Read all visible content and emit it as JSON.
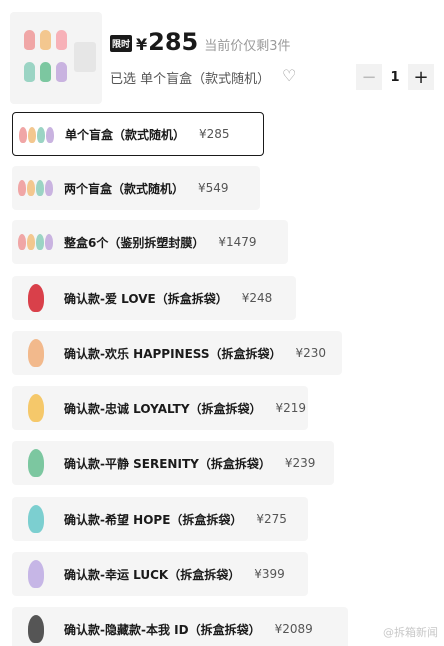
{
  "product": {
    "tag": "限时",
    "currency": "¥",
    "price": "285",
    "stock_text": "当前价仅剩3件",
    "selected_text": "已选 单个盲盒（款式随机）",
    "quantity": "1",
    "minus_symbol": "−",
    "plus_symbol": "+"
  },
  "options": [
    {
      "name": "单个盲盒（款式随机）",
      "price": "¥285",
      "selected": true,
      "colors": [
        "#f0a6a6",
        "#f3c78f",
        "#9bd4c4",
        "#c9b3e0"
      ]
    },
    {
      "name": "两个盲盒（款式随机）",
      "price": "¥549",
      "selected": false,
      "colors": [
        "#f0a6a6",
        "#f3c78f",
        "#9bd4c4",
        "#c9b3e0"
      ]
    },
    {
      "name": "整盒6个（鉴别拆塑封膜）",
      "price": "¥1479",
      "selected": false,
      "colors": [
        "#f0a6a6",
        "#f3c78f",
        "#9bd4c4",
        "#c9b3e0"
      ]
    },
    {
      "name": "确认款-爱 LOVE（拆盒拆袋）",
      "price": "¥248",
      "selected": false,
      "colors": [
        "#d9404a"
      ]
    },
    {
      "name": "确认款-欢乐 HAPPINESS（拆盒拆袋）",
      "price": "¥230",
      "selected": false,
      "colors": [
        "#f2b98c"
      ]
    },
    {
      "name": "确认款-忠诚 LOYALTY（拆盒拆袋）",
      "price": "¥219",
      "selected": false,
      "colors": [
        "#f5c86a"
      ]
    },
    {
      "name": "确认款-平静 SERENITY（拆盒拆袋）",
      "price": "¥239",
      "selected": false,
      "colors": [
        "#7cc7a0"
      ]
    },
    {
      "name": "确认款-希望 HOPE（拆盒拆袋）",
      "price": "¥275",
      "selected": false,
      "colors": [
        "#7ccfd0"
      ]
    },
    {
      "name": "确认款-幸运 LUCK（拆盒拆袋）",
      "price": "¥399",
      "selected": false,
      "colors": [
        "#c6b6e6"
      ]
    },
    {
      "name": "确认款-隐藏款-本我 ID（拆盒拆袋）",
      "price": "¥2089",
      "selected": false,
      "colors": [
        "#555555"
      ]
    }
  ],
  "watermark": "@拆箱新闻"
}
